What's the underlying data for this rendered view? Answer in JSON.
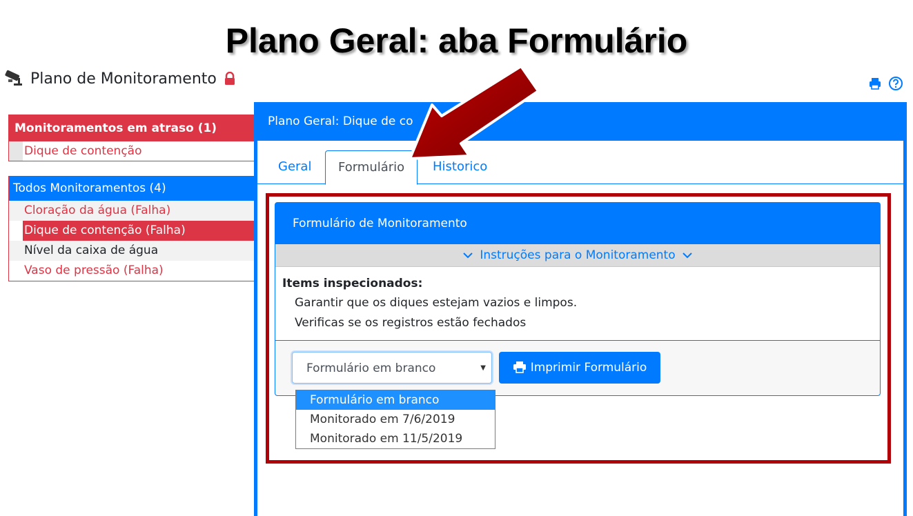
{
  "slide": {
    "title": "Plano Geral: aba Formulário"
  },
  "header": {
    "title": "Plano de Monitoramento"
  },
  "sidebar": {
    "late": {
      "header": "Monitoramentos em atraso (1)",
      "items": [
        {
          "label": "Dique de contenção"
        }
      ]
    },
    "all": {
      "header": "Todos Monitoramentos (4)",
      "items": [
        {
          "label": "Cloração da água (Falha)"
        },
        {
          "label": "Dique de contenção (Falha)"
        },
        {
          "label": "Nível da caixa de água"
        },
        {
          "label": "Vaso de pressão (Falha)"
        }
      ]
    }
  },
  "main": {
    "title": "Plano Geral: Dique de co",
    "tabs": [
      {
        "label": "Geral"
      },
      {
        "label": "Formulário"
      },
      {
        "label": "Historico"
      }
    ],
    "card": {
      "title": "Formulário de Monitoramento",
      "instructions": "Instruções para o Monitoramento",
      "items_title": "Items inspecionados:",
      "items": [
        "Garantir que os diques estejam vazios e limpos.",
        "Verificas se os registros estão fechados"
      ],
      "select_value": "Formulário em branco",
      "print_button": "Imprimir Formulário",
      "options": [
        "Formulário em branco",
        "Monitorado em 7/6/2019",
        "Monitorado em 11/5/2019"
      ]
    }
  },
  "colors": {
    "primary": "#007bff",
    "danger": "#dc3545",
    "highlight": "#b00008",
    "arrow": "#a80000"
  }
}
